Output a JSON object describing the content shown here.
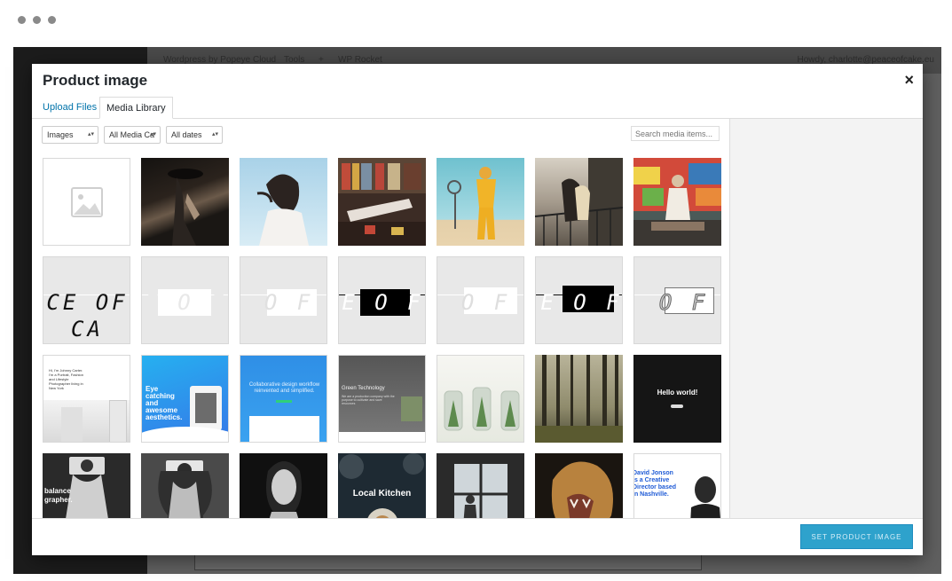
{
  "adminbar": {
    "site": "Wordpress by Popeye Cloud",
    "tools": "Tools",
    "plus": "+",
    "rocket": "WP Rocket",
    "howdy": "Howdy, charlotte@peaceofcake.eu"
  },
  "modal": {
    "title": "Product image",
    "close_glyph": "×",
    "tabs": [
      {
        "label": "Upload Files"
      },
      {
        "label": "Media Library"
      }
    ],
    "filters": {
      "type": "Images",
      "category": "All Media Ca",
      "dates": "All dates",
      "caret": "▴▾"
    },
    "search": {
      "placeholder": "Search media items..."
    },
    "thumbs": {
      "logo_texts": {
        "cake": "CE OF CA",
        "eof": "E O F",
        "of": "O F"
      },
      "web": {
        "johnny": "Hi, I'm Johnny Carter. I'm a Portrait, Fashion and Lifestyle Photographer living in New York",
        "eye": "Eye catching and awesome aesthetics.",
        "collab": "Collaborative design workflow reinvented and simplified.",
        "green": "Green Technology",
        "green_sub": "We are a production company with the purpose to cultivate and save resources",
        "hello": "Hello world!",
        "balance": "balance",
        "grapher": "grapher.",
        "kitchen": "Local Kitchen",
        "david": "David Jonson is a Creative Director based in Nashville."
      }
    },
    "footer": {
      "button": "SET PRODUCT IMAGE"
    }
  },
  "colors": {
    "accent": "#0073aa",
    "button": "#2ea2cc",
    "overlay": "#5c5c5c"
  }
}
